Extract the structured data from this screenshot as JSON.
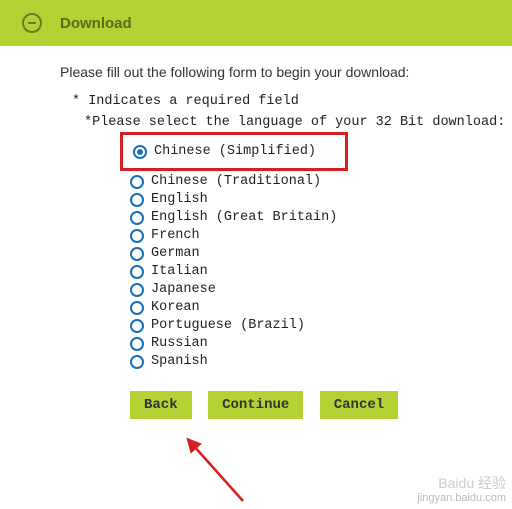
{
  "header": {
    "title": "Download"
  },
  "intro": "Please fill out the following form to begin your download:",
  "required_note": "* Indicates a required field",
  "select_prompt": "*Please select the language of your 32 Bit download:",
  "languages": [
    "Chinese (Simplified)",
    "Chinese (Traditional)",
    "English",
    "English (Great Britain)",
    "French",
    "German",
    "Italian",
    "Japanese",
    "Korean",
    "Portuguese (Brazil)",
    "Russian",
    "Spanish"
  ],
  "selected_index": 0,
  "buttons": {
    "back": "Back",
    "continue": "Continue",
    "cancel": "Cancel"
  },
  "watermark": {
    "brand": "Baidu 经验",
    "url": "jingyan.baidu.com"
  }
}
